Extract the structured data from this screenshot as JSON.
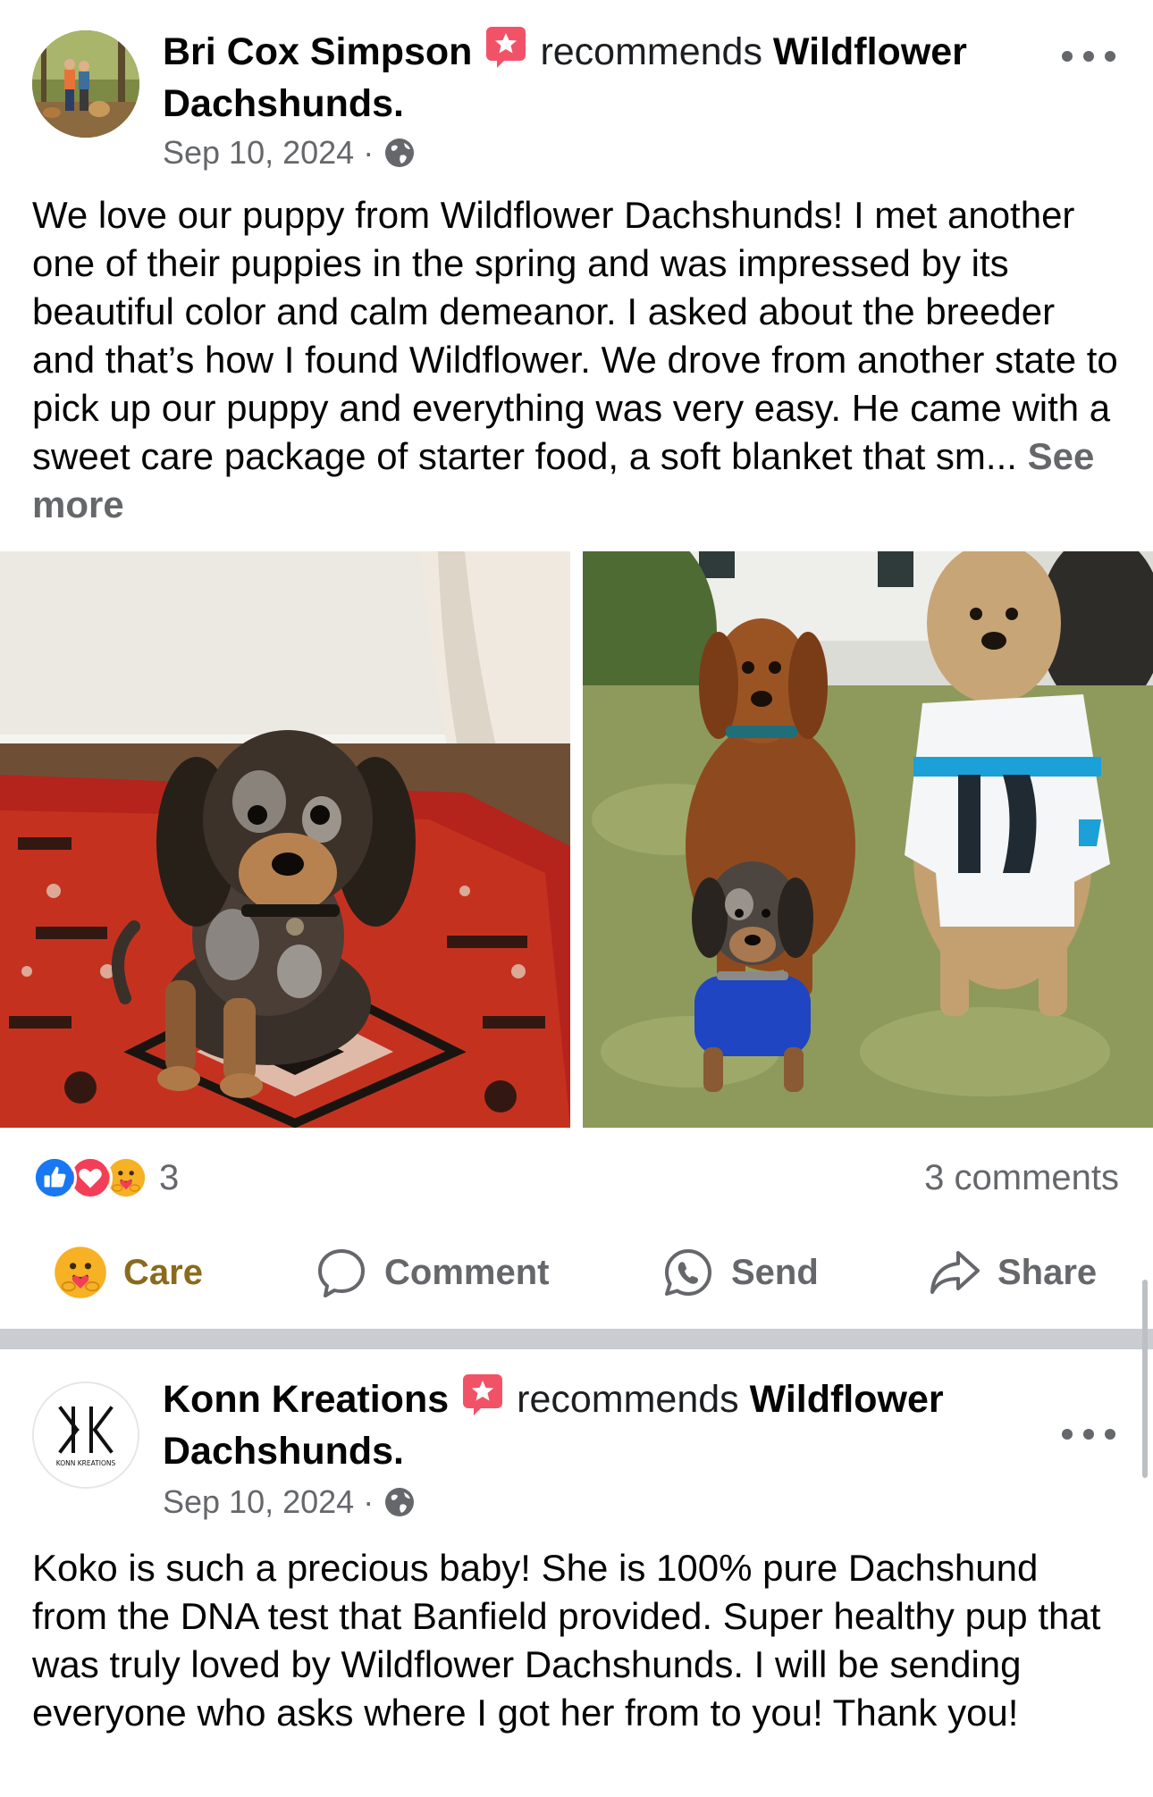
{
  "posts": [
    {
      "author": "Bri Cox Simpson",
      "action_text": "recommends",
      "page_name": "Wildflower Dachshunds.",
      "date": "Sep 10, 2024",
      "separator": "·",
      "audience_icon": "globe-icon",
      "body": "We love our puppy from Wildflower Dachshunds! I met another one of their puppies in the spring and was impressed by its beautiful color and calm demeanor. I asked about the breeder and that’s how I found Wildflower. We drove from another state to pick up our puppy and everything was very easy. He came with a sweet care package of starter food, a soft blanket that sm...",
      "see_more": "See more",
      "reaction_icons": [
        "like-icon",
        "love-icon",
        "care-icon"
      ],
      "reaction_count": "3",
      "comments_count": "3 comments",
      "actions": {
        "care": "Care",
        "comment": "Comment",
        "send": "Send",
        "share": "Share"
      }
    },
    {
      "author": "Konn Kreations",
      "action_text": "recommends",
      "page_name": "Wildflower Dachshunds.",
      "date": "Sep 10, 2024",
      "separator": "·",
      "audience_icon": "globe-icon",
      "avatar_wordmark": "KONN KREATIONS",
      "body": "Koko is such a precious baby! She is 100% pure Dachshund from the DNA test that Banfield provided. Super healthy pup that was truly loved by Wildflower Dachshunds. I will be sending everyone who asks where I got her from to you! Thank you!"
    }
  ],
  "colors": {
    "like_blue": "#1877f2",
    "love_red": "#f33e58",
    "care_yellow": "#f7b125",
    "recommend_red": "#f25268",
    "secondary_text": "#65676b"
  }
}
